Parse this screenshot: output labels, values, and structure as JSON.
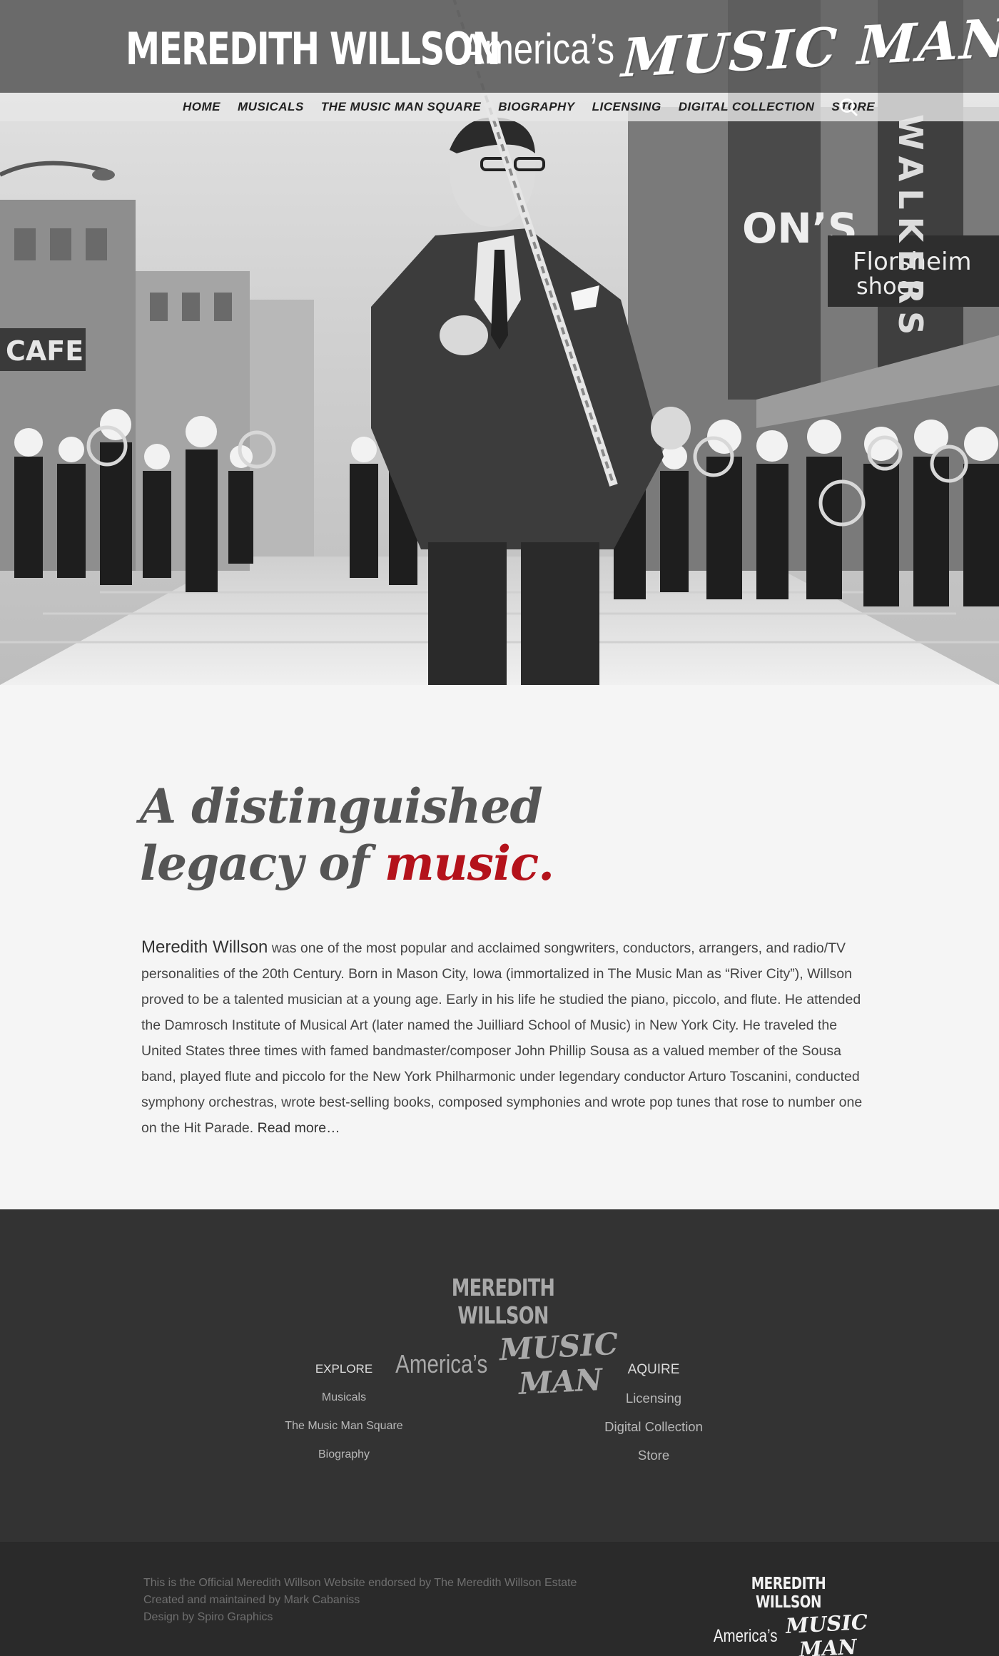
{
  "header": {
    "brand_name": "MEREDITH WILLSON",
    "brand_sub": "America’s",
    "brand_music_man": "MUSIC MAN"
  },
  "nav": {
    "items": [
      {
        "label": "HOME"
      },
      {
        "label": "MUSICALS"
      },
      {
        "label": "THE MUSIC MAN SQUARE"
      },
      {
        "label": "BIOGRAPHY"
      },
      {
        "label": "LICENSING"
      },
      {
        "label": "DIGITAL COLLECTION"
      },
      {
        "label": "STORE"
      }
    ],
    "search_icon": "search-icon"
  },
  "hero": {
    "signs": {
      "cafe": "CAFE",
      "store": "ON’S",
      "florsheim_1": "Florsheim",
      "florsheim_2": "shoes",
      "walkers": "WALKERS"
    }
  },
  "intro": {
    "headline_line1": "A distinguished",
    "headline_line2_prefix": "legacy of ",
    "headline_accent": "music.",
    "accent_color": "#b4121b",
    "lead_name": "Meredith Willson",
    "body": " was one of the most popular and acclaimed songwriters, conductors, arrangers, and radio/TV personalities of the 20th Century.  Born in Mason City, Iowa (immortalized in The Music Man as “River City”), Willson proved to be a talented musician at a young age.  Early in his life he studied the piano, piccolo, and flute.  He attended the Damrosch Institute of Musical Art (later named the Juilliard School of Music) in New York City.  He traveled the United States three times with famed bandmaster/composer John Phillip Sousa as a valued member of the Sousa band, played flute and piccolo for the New York Philharmonic under legendary conductor Arturo Toscanini, conducted symphony orchestras, wrote best-selling books, composed symphonies and wrote pop tunes that rose to number one on the Hit Parade.  ",
    "read_more": "Read more…"
  },
  "footer": {
    "logo_name": "MEREDITH WILLSON",
    "logo_sub": "America’s",
    "logo_music_man": "MUSIC MAN",
    "explore": {
      "heading": "EXPLORE",
      "links": [
        "Musicals",
        "The Music Man Square",
        "Biography"
      ]
    },
    "acquire": {
      "heading": "AQUIRE",
      "links": [
        "Licensing",
        "Digital Collection",
        "Store"
      ]
    },
    "credits": [
      "This is the Official Meredith Willson Website endorsed by The Meredith Willson Estate",
      "Created and maintained by Mark Cabaniss",
      "Design by Spiro Graphics"
    ],
    "bottom_logo_name": "MEREDITH WILLSON",
    "bottom_logo_sub": "America’s",
    "bottom_logo_music_man": "MUSIC MAN"
  }
}
